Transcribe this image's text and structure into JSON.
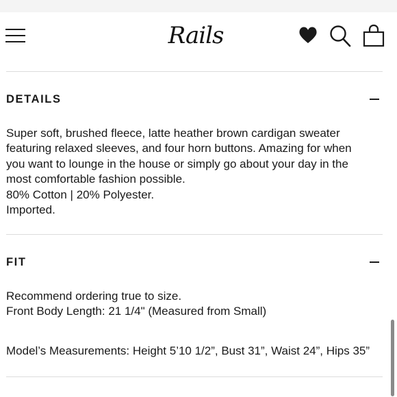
{
  "header": {
    "brand": "Rails",
    "icons": [
      "menu-icon",
      "heart-icon",
      "search-icon",
      "bag-icon"
    ]
  },
  "details": {
    "title": "DETAILS",
    "toggle_icon": "minus-icon",
    "lines": [
      "Super soft, brushed fleece, latte heather brown cardigan sweater",
      "featuring relaxed sleeves, and four horn buttons. Amazing for when",
      "you want to lounge in the house or simply go about your day in the",
      "most comfortable fashion possible.",
      "80% Cotton | 20% Polyester.",
      "Imported."
    ]
  },
  "fit": {
    "title": "FIT",
    "toggle_icon": "minus-icon",
    "lines": [
      "Recommend ordering true to size.",
      "Front Body Length: 21 1/4\" (Measured from Small)"
    ],
    "model_measurements": "Model’s Measurements: Height 5’10 1/2”, Bust 31”, Waist 24”, Hips 35”"
  }
}
